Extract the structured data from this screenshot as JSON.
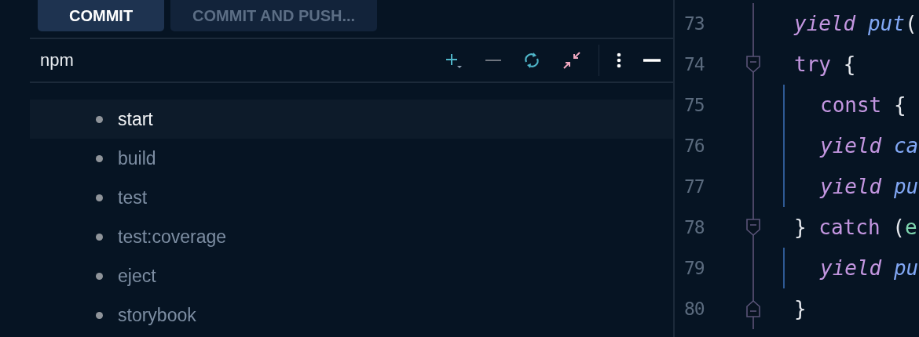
{
  "buttons": [
    {
      "label": "COMMIT",
      "disabled": false
    },
    {
      "label": "COMMIT AND PUSH...",
      "disabled": true
    }
  ],
  "panel": {
    "title": "npm",
    "toolbar": [
      {
        "kind": "add",
        "disabled": false
      },
      {
        "kind": "remove",
        "disabled": true
      },
      {
        "kind": "refresh",
        "disabled": false
      },
      {
        "kind": "collapse",
        "disabled": false
      },
      {
        "kind": "more",
        "disabled": false
      },
      {
        "kind": "hide",
        "disabled": false
      }
    ]
  },
  "scripts": [
    {
      "name": "start",
      "selected": true
    },
    {
      "name": "build",
      "selected": false
    },
    {
      "name": "test",
      "selected": false
    },
    {
      "name": "test:coverage",
      "selected": false
    },
    {
      "name": "eject",
      "selected": false
    },
    {
      "name": "storybook",
      "selected": false
    }
  ],
  "editor": {
    "lines": [
      {
        "number": "73",
        "fold_start": false,
        "fold_end": false,
        "guide": false,
        "tokens": [
          {
            "text": "yield ",
            "kind": "keyword-italic"
          },
          {
            "text": "put",
            "kind": "function"
          },
          {
            "text": "(",
            "kind": "punct"
          }
        ]
      },
      {
        "number": "74",
        "fold_start": true,
        "fold_end": false,
        "guide": false,
        "tokens": [
          {
            "text": "try ",
            "kind": "keyword"
          },
          {
            "text": "{",
            "kind": "punct"
          }
        ]
      },
      {
        "number": "75",
        "fold_start": false,
        "fold_end": false,
        "guide": true,
        "tokens": [
          {
            "text": "const ",
            "kind": "keyword"
          },
          {
            "text": "{",
            "kind": "punct"
          }
        ]
      },
      {
        "number": "76",
        "fold_start": false,
        "fold_end": false,
        "guide": true,
        "tokens": [
          {
            "text": "yield ",
            "kind": "keyword-italic"
          },
          {
            "text": "ca",
            "kind": "function"
          }
        ]
      },
      {
        "number": "77",
        "fold_start": false,
        "fold_end": false,
        "guide": true,
        "tokens": [
          {
            "text": "yield ",
            "kind": "keyword-italic"
          },
          {
            "text": "pu",
            "kind": "function"
          }
        ]
      },
      {
        "number": "78",
        "fold_start": true,
        "fold_end": false,
        "guide": false,
        "tokens": [
          {
            "text": "} ",
            "kind": "punct"
          },
          {
            "text": "catch ",
            "kind": "keyword"
          },
          {
            "text": "(",
            "kind": "punct"
          },
          {
            "text": "e",
            "kind": "param"
          }
        ]
      },
      {
        "number": "79",
        "fold_start": false,
        "fold_end": false,
        "guide": true,
        "tokens": [
          {
            "text": "yield ",
            "kind": "keyword-italic"
          },
          {
            "text": "pu",
            "kind": "function"
          }
        ]
      },
      {
        "number": "80",
        "fold_start": false,
        "fold_end": true,
        "guide": false,
        "tokens": [
          {
            "text": "}",
            "kind": "punct"
          }
        ]
      }
    ]
  }
}
